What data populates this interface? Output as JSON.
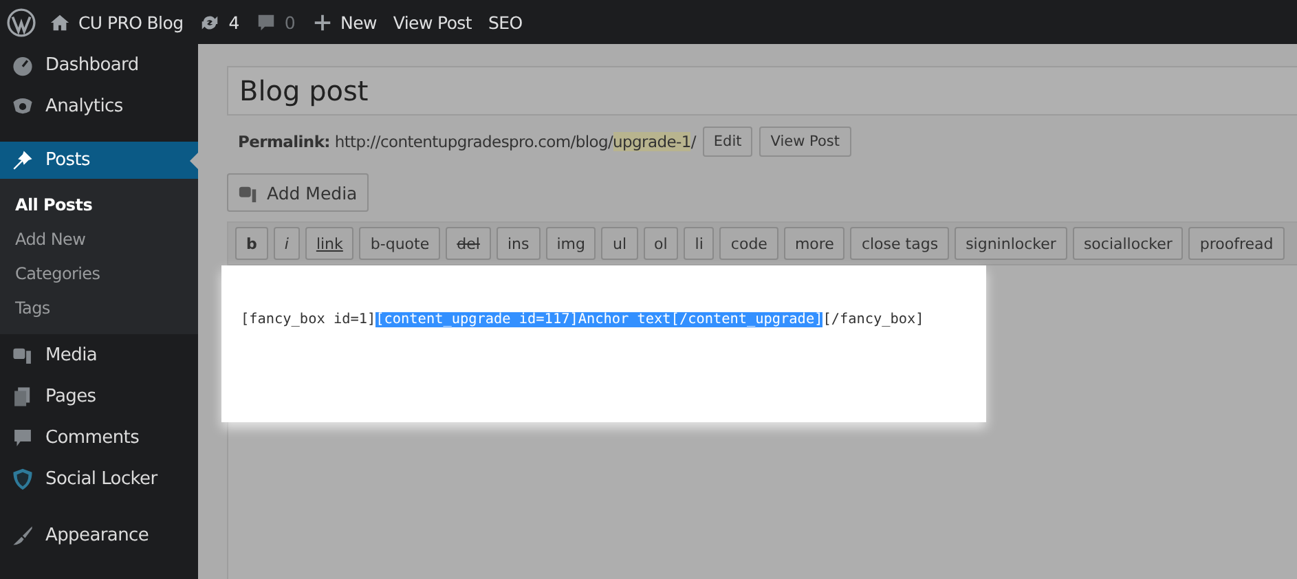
{
  "admin_bar": {
    "items": [
      {
        "kind": "home",
        "label": "CU PRO Blog"
      },
      {
        "kind": "updates",
        "label": "4"
      },
      {
        "kind": "comments",
        "label": "0"
      },
      {
        "kind": "new",
        "label": "New"
      },
      {
        "kind": "text",
        "label": "View Post"
      },
      {
        "kind": "text",
        "label": "SEO"
      }
    ]
  },
  "sidebar": {
    "items": [
      {
        "kind": "dashboard",
        "label": "Dashboard",
        "selected": false
      },
      {
        "kind": "analytics",
        "label": "Analytics",
        "selected": false
      },
      {
        "kind": "posts",
        "label": "Posts",
        "selected": true,
        "children": [
          {
            "label": "All Posts",
            "selected": true
          },
          {
            "label": "Add New",
            "selected": false
          },
          {
            "label": "Categories",
            "selected": false
          },
          {
            "label": "Tags",
            "selected": false
          }
        ]
      },
      {
        "kind": "media",
        "label": "Media",
        "selected": false
      },
      {
        "kind": "pages",
        "label": "Pages",
        "selected": false
      },
      {
        "kind": "comments",
        "label": "Comments",
        "selected": false
      },
      {
        "kind": "locker",
        "label": "Social Locker",
        "selected": false
      },
      {
        "kind": "appearance",
        "label": "Appearance",
        "selected": false
      }
    ]
  },
  "post": {
    "title": "Blog post",
    "permalink": {
      "label": "Permalink:",
      "url": "http://contentupgradespro.com/blog/",
      "slug": "upgrade-1",
      "suffix": "/"
    },
    "permalink_buttons": [
      "Edit",
      "View Post"
    ],
    "add_media": "Add Media",
    "toolbar": [
      {
        "label": "b",
        "kind": "bold"
      },
      {
        "label": "i",
        "kind": "italic"
      },
      {
        "label": "link",
        "kind": "link"
      },
      {
        "label": "b-quote",
        "kind": "plain"
      },
      {
        "label": "del",
        "kind": "strike"
      },
      {
        "label": "ins",
        "kind": "plain"
      },
      {
        "label": "img",
        "kind": "plain"
      },
      {
        "label": "ul",
        "kind": "plain"
      },
      {
        "label": "ol",
        "kind": "plain"
      },
      {
        "label": "li",
        "kind": "plain"
      },
      {
        "label": "code",
        "kind": "plain"
      },
      {
        "label": "more",
        "kind": "plain"
      },
      {
        "label": "close tags",
        "kind": "plain"
      },
      {
        "label": "signinlocker",
        "kind": "plain"
      },
      {
        "label": "sociallocker",
        "kind": "plain"
      },
      {
        "label": "proofread",
        "kind": "plain"
      }
    ],
    "content": [
      {
        "text": "[fancy_box id=1]",
        "selected": false
      },
      {
        "text": "[content_upgrade id=117]Anchor text[/content_upgrade]",
        "selected": true
      },
      {
        "text": "[/fancy_box]",
        "selected": false
      }
    ]
  }
}
